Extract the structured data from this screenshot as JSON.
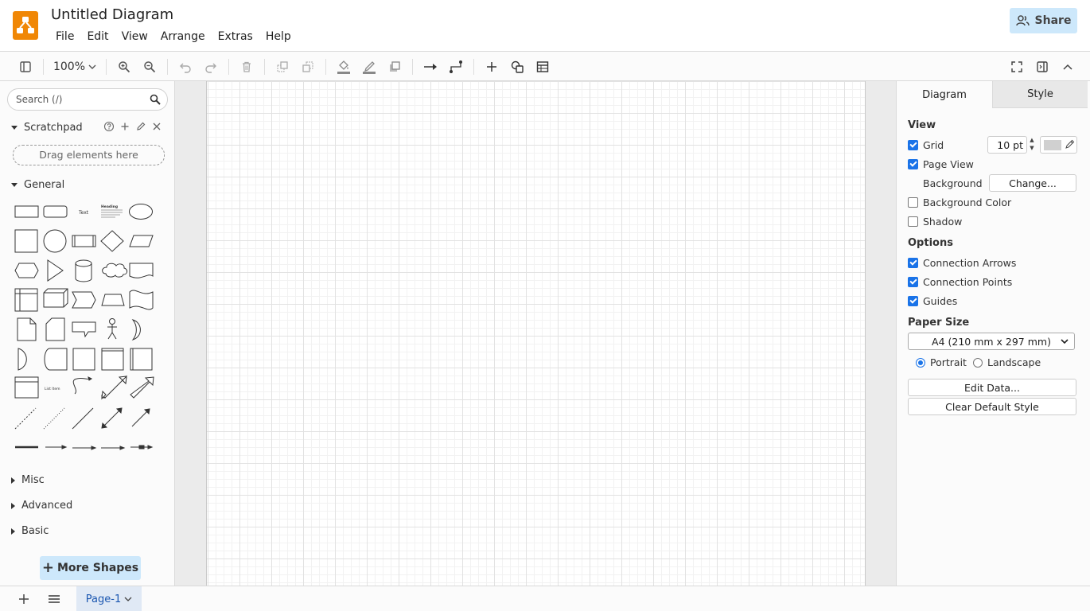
{
  "app": {
    "title": "Untitled Diagram",
    "brand_color": "#f08705",
    "accent_color": "#cde8fb"
  },
  "menu": [
    "File",
    "Edit",
    "View",
    "Arrange",
    "Extras",
    "Help"
  ],
  "share": {
    "label": "Share",
    "icon": "people-icon"
  },
  "toolbar": {
    "zoom": "100%",
    "icons": [
      "sidebar-toggle-icon",
      "zoom-in-icon",
      "zoom-out-icon",
      "undo-icon",
      "redo-icon",
      "delete-icon",
      "to-front-icon",
      "to-back-icon",
      "fill-color-icon",
      "line-color-icon",
      "shadow-icon",
      "connection-icon",
      "waypoints-icon",
      "insert-icon",
      "shapes-icon",
      "table-icon",
      "fullscreen-icon",
      "format-panel-icon",
      "collapse-icon"
    ]
  },
  "sidebar": {
    "search_placeholder": "Search (/)",
    "scratchpad": {
      "label": "Scratchpad",
      "drop_text": "Drag elements here"
    },
    "general": {
      "label": "General",
      "text_shape": "Text",
      "heading_shape": "Heading",
      "list_item": "List Item"
    },
    "collapsed_sections": [
      "Misc",
      "Advanced",
      "Basic"
    ],
    "more_shapes": "More Shapes"
  },
  "format_panel": {
    "tabs": [
      "Diagram",
      "Style"
    ],
    "active_tab": "Diagram",
    "view": {
      "heading": "View",
      "grid_label": "Grid",
      "grid_checked": true,
      "grid_size": "10 pt",
      "grid_color": "#d0d0d0",
      "page_view_label": "Page View",
      "page_view_checked": true,
      "background_label": "Background",
      "change_button": "Change...",
      "background_color_label": "Background Color",
      "background_color_checked": false,
      "shadow_label": "Shadow",
      "shadow_checked": false
    },
    "options": {
      "heading": "Options",
      "connection_arrows": "Connection Arrows",
      "connection_points": "Connection Points",
      "guides": "Guides"
    },
    "paper": {
      "heading": "Paper Size",
      "selected": "A4 (210 mm x 297 mm)",
      "portrait": "Portrait",
      "landscape": "Landscape",
      "orientation": "Portrait"
    },
    "edit_data_button": "Edit Data...",
    "clear_default_style_button": "Clear Default Style"
  },
  "footer": {
    "page_tab": "Page-1"
  }
}
